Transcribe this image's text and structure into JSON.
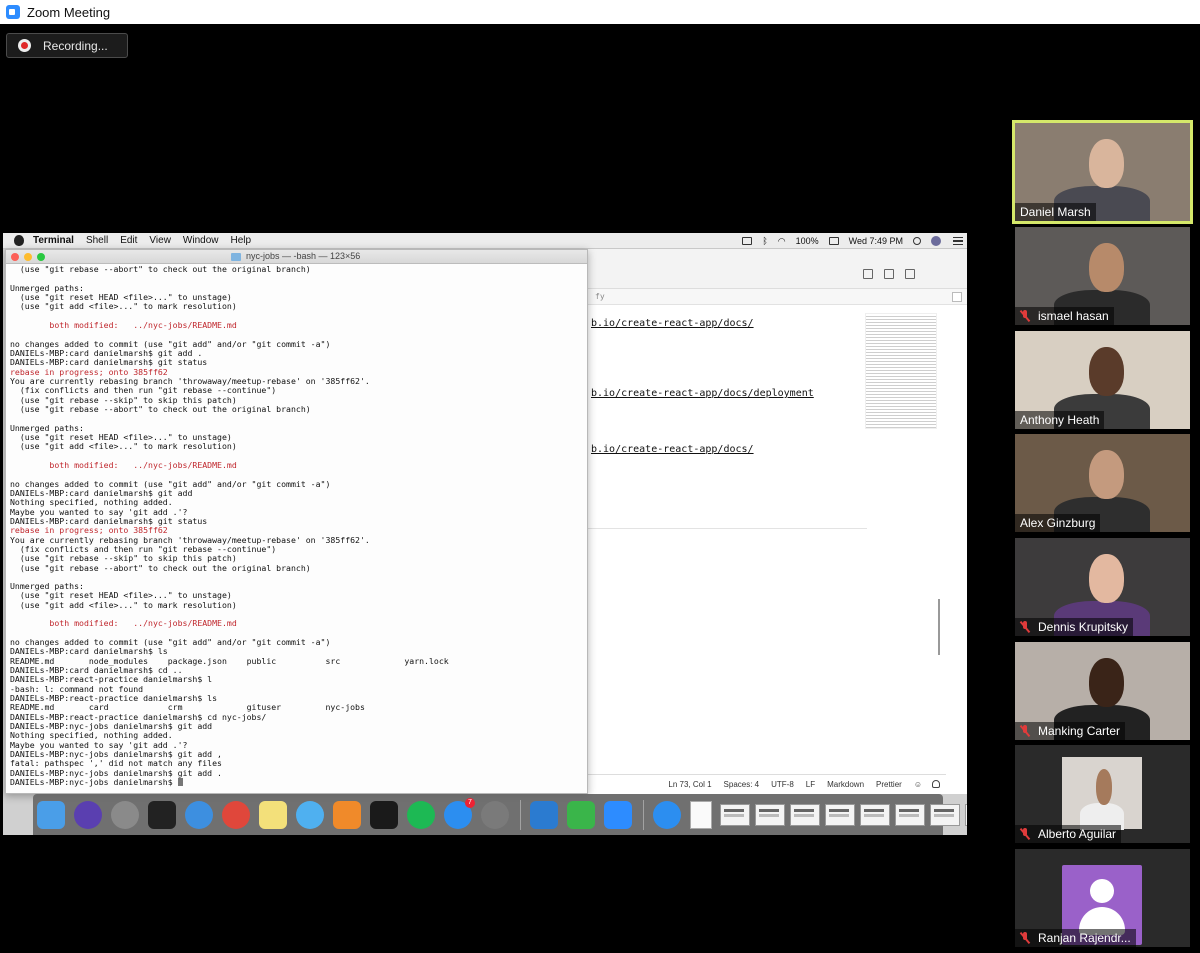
{
  "window": {
    "title": "Zoom Meeting"
  },
  "recording": {
    "label": "Recording..."
  },
  "menubar": {
    "app": "Terminal",
    "items": [
      "Shell",
      "Edit",
      "View",
      "Window",
      "Help"
    ],
    "battery": "100%",
    "clock": "Wed 7:49 PM"
  },
  "terminal": {
    "title": "nyc-jobs — -bash — 123×56",
    "lines": [
      {
        "t": "  (use \"git rebase --abort\" to check out the original branch)",
        "c": ""
      },
      {
        "t": "",
        "c": ""
      },
      {
        "t": "Unmerged paths:",
        "c": ""
      },
      {
        "t": "  (use \"git reset HEAD <file>...\" to unstage)",
        "c": ""
      },
      {
        "t": "  (use \"git add <file>...\" to mark resolution)",
        "c": ""
      },
      {
        "t": "",
        "c": ""
      },
      {
        "t": "        both modified:   ../nyc-jobs/README.md",
        "c": "red"
      },
      {
        "t": "",
        "c": ""
      },
      {
        "t": "no changes added to commit (use \"git add\" and/or \"git commit -a\")",
        "c": ""
      },
      {
        "t": "DANIELs-MBP:card danielmarsh$ git add .",
        "c": ""
      },
      {
        "t": "DANIELs-MBP:card danielmarsh$ git status",
        "c": ""
      },
      {
        "t": "rebase in progress; onto 385ff62",
        "c": "red"
      },
      {
        "t": "You are currently rebasing branch 'throwaway/meetup-rebase' on '385ff62'.",
        "c": ""
      },
      {
        "t": "  (fix conflicts and then run \"git rebase --continue\")",
        "c": ""
      },
      {
        "t": "  (use \"git rebase --skip\" to skip this patch)",
        "c": ""
      },
      {
        "t": "  (use \"git rebase --abort\" to check out the original branch)",
        "c": ""
      },
      {
        "t": "",
        "c": ""
      },
      {
        "t": "Unmerged paths:",
        "c": ""
      },
      {
        "t": "  (use \"git reset HEAD <file>...\" to unstage)",
        "c": ""
      },
      {
        "t": "  (use \"git add <file>...\" to mark resolution)",
        "c": ""
      },
      {
        "t": "",
        "c": ""
      },
      {
        "t": "        both modified:   ../nyc-jobs/README.md",
        "c": "red"
      },
      {
        "t": "",
        "c": ""
      },
      {
        "t": "no changes added to commit (use \"git add\" and/or \"git commit -a\")",
        "c": ""
      },
      {
        "t": "DANIELs-MBP:card danielmarsh$ git add",
        "c": ""
      },
      {
        "t": "Nothing specified, nothing added.",
        "c": ""
      },
      {
        "t": "Maybe you wanted to say 'git add .'?",
        "c": ""
      },
      {
        "t": "DANIELs-MBP:card danielmarsh$ git status",
        "c": ""
      },
      {
        "t": "rebase in progress; onto 385ff62",
        "c": "red"
      },
      {
        "t": "You are currently rebasing branch 'throwaway/meetup-rebase' on '385ff62'.",
        "c": ""
      },
      {
        "t": "  (fix conflicts and then run \"git rebase --continue\")",
        "c": ""
      },
      {
        "t": "  (use \"git rebase --skip\" to skip this patch)",
        "c": ""
      },
      {
        "t": "  (use \"git rebase --abort\" to check out the original branch)",
        "c": ""
      },
      {
        "t": "",
        "c": ""
      },
      {
        "t": "Unmerged paths:",
        "c": ""
      },
      {
        "t": "  (use \"git reset HEAD <file>...\" to unstage)",
        "c": ""
      },
      {
        "t": "  (use \"git add <file>...\" to mark resolution)",
        "c": ""
      },
      {
        "t": "",
        "c": ""
      },
      {
        "t": "        both modified:   ../nyc-jobs/README.md",
        "c": "red"
      },
      {
        "t": "",
        "c": ""
      },
      {
        "t": "no changes added to commit (use \"git add\" and/or \"git commit -a\")",
        "c": ""
      },
      {
        "t": "DANIELs-MBP:card danielmarsh$ ls",
        "c": ""
      },
      {
        "t": "README.md       node_modules    package.json    public          src             yarn.lock",
        "c": ""
      },
      {
        "t": "DANIELs-MBP:card danielmarsh$ cd ..",
        "c": ""
      },
      {
        "t": "DANIELs-MBP:react-practice danielmarsh$ l",
        "c": ""
      },
      {
        "t": "-bash: l: command not found",
        "c": ""
      },
      {
        "t": "DANIELs-MBP:react-practice danielmarsh$ ls",
        "c": ""
      },
      {
        "t": "README.md       card            crm             gituser         nyc-jobs",
        "c": ""
      },
      {
        "t": "DANIELs-MBP:react-practice danielmarsh$ cd nyc-jobs/",
        "c": ""
      },
      {
        "t": "DANIELs-MBP:nyc-jobs danielmarsh$ git add",
        "c": ""
      },
      {
        "t": "Nothing specified, nothing added.",
        "c": ""
      },
      {
        "t": "Maybe you wanted to say 'git add .'?",
        "c": ""
      },
      {
        "t": "DANIELs-MBP:nyc-jobs danielmarsh$ git add ,",
        "c": ""
      },
      {
        "t": "fatal: pathspec ',' did not match any files",
        "c": ""
      },
      {
        "t": "DANIELs-MBP:nyc-jobs danielmarsh$ git add .",
        "c": ""
      },
      {
        "t": "DANIELs-MBP:nyc-jobs danielmarsh$ ",
        "c": "cursor"
      }
    ]
  },
  "editor": {
    "tab_text": "fy",
    "links": [
      "b.io/create-react-app/docs/",
      "b.io/create-react-app/docs/deployment",
      "b.io/create-react-app/docs/"
    ],
    "status": [
      "Ln 73, Col 1",
      "Spaces: 4",
      "UTF-8",
      "LF",
      "Markdown",
      "Prettier"
    ]
  },
  "dock": {
    "apps": [
      {
        "icon": "finder-icon",
        "color": "#4a9ee8"
      },
      {
        "icon": "siri-icon",
        "color": "#5a3fb0"
      },
      {
        "icon": "launchpad-icon",
        "color": "#8a8a8a"
      },
      {
        "icon": "terminal-icon",
        "color": "#222222"
      },
      {
        "icon": "safari-icon",
        "color": "#3d8fe0"
      },
      {
        "icon": "chrome-icon",
        "color": "#e0473b"
      },
      {
        "icon": "notes-icon",
        "color": "#f3e07a"
      },
      {
        "icon": "messages-icon",
        "color": "#4fb0f0"
      },
      {
        "icon": "books-icon",
        "color": "#f08a2a"
      },
      {
        "icon": "pycharm-icon",
        "color": "#1a1a1a"
      },
      {
        "icon": "spotify-icon",
        "color": "#1db954"
      },
      {
        "icon": "app-store-icon",
        "color": "#2c8ef0",
        "badge": "7"
      },
      {
        "icon": "system-preferences-icon",
        "color": "#7a7a7a"
      }
    ],
    "apps2": [
      {
        "icon": "vscode-icon",
        "color": "#2b7bd0"
      },
      {
        "icon": "facetime-icon",
        "color": "#3ab54a"
      },
      {
        "icon": "zoom-icon",
        "color": "#2d8cff"
      }
    ],
    "apps3": [
      {
        "icon": "app-store-folder-icon",
        "color": "#2c8ef0"
      }
    ],
    "thumbs": 8
  },
  "participants": [
    {
      "name": "Daniel Marsh",
      "muted": false,
      "active": true,
      "bg": "#8a7d70",
      "skin": "#d9b59c",
      "shirt": "#4a4a52"
    },
    {
      "name": "ismael hasan",
      "muted": true,
      "active": false,
      "bg": "#5d5a58",
      "skin": "#b78a6a",
      "shirt": "#2b2b2b"
    },
    {
      "name": "Anthony Heath",
      "muted": false,
      "active": false,
      "bg": "#d8cfc2",
      "skin": "#5a3b2a",
      "shirt": "#3b3b3b"
    },
    {
      "name": "Alex Ginzburg",
      "muted": false,
      "active": false,
      "bg": "#6c5a48",
      "skin": "#c49a7e",
      "shirt": "#2e2e2e"
    },
    {
      "name": "Dennis Krupitsky",
      "muted": true,
      "active": false,
      "bg": "#3d3b3c",
      "skin": "#e3b8a0",
      "shirt": "#5a3a78"
    },
    {
      "name": "Manking Carter",
      "muted": true,
      "active": false,
      "bg": "#b7afa8",
      "skin": "#3a2418",
      "shirt": "#222222"
    },
    {
      "name": "Alberto Aguilar",
      "muted": true,
      "active": false,
      "bg": "#2a2a2a",
      "skin": "#a57a5c",
      "shirt": "#eeeeee",
      "small": true
    },
    {
      "name": "Ranjan Rajendr...",
      "muted": true,
      "active": false,
      "bg": "#2a2a2a",
      "avatar": true
    }
  ]
}
